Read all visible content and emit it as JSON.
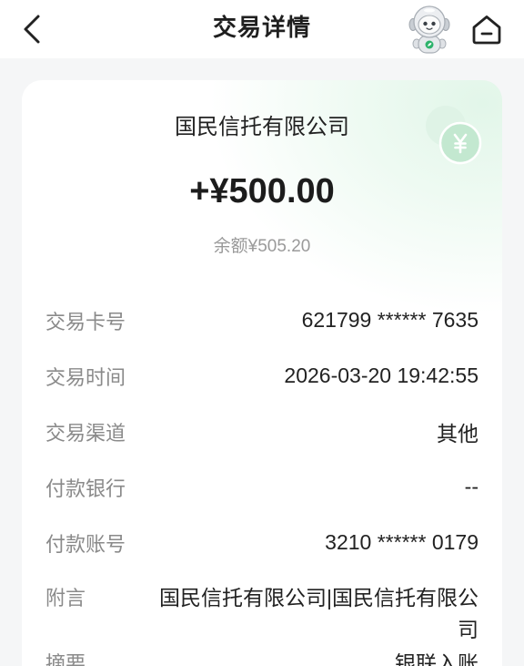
{
  "header": {
    "title": "交易详情",
    "back_icon": "chevron-left-icon",
    "assistant_icon": "assistant-mascot-icon",
    "home_icon": "home-icon"
  },
  "summary": {
    "counterparty": "国民信托有限公司",
    "amount": "+¥500.00",
    "balance": "余额¥505.20",
    "badge_icon": "yuan-coin-icon"
  },
  "details": [
    {
      "label": "交易卡号",
      "value": "621799 ****** 7635"
    },
    {
      "label": "交易时间",
      "value": "2026-03-20 19:42:55"
    },
    {
      "label": "交易渠道",
      "value": "其他"
    },
    {
      "label": "付款银行",
      "value": "--"
    },
    {
      "label": "付款账号",
      "value": "3210 ****** 0179"
    },
    {
      "label": "附言",
      "value": "国民信托有限公司|国民信托有限公司"
    },
    {
      "label": "摘要",
      "value": "银联入账"
    }
  ],
  "colors": {
    "page_background": "#f5f6f7",
    "card_background": "#ffffff",
    "accent_green": "#2db36b",
    "coin_green": "#c3e8d0",
    "label_gray": "#8a8a8a",
    "text_dark": "#222222"
  }
}
